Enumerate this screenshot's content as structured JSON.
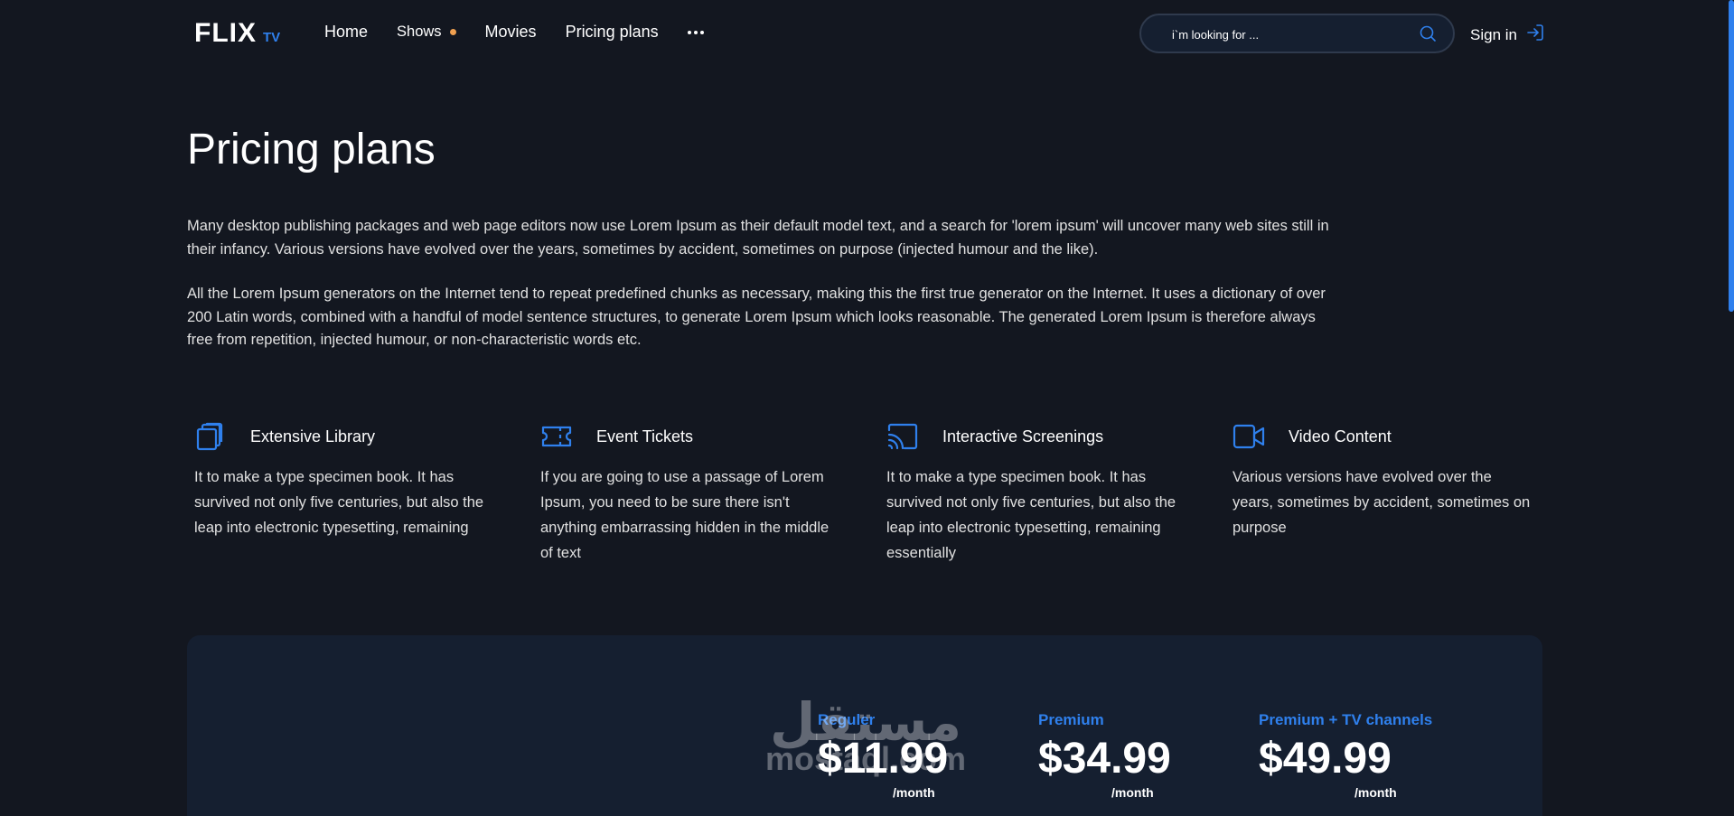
{
  "header": {
    "logo_main": "FLIX",
    "logo_sub": "TV",
    "nav": [
      {
        "label": "Home"
      },
      {
        "label": "Shows"
      },
      {
        "label": "Movies"
      },
      {
        "label": "Pricing plans"
      }
    ],
    "search_placeholder": "i`m looking for ...",
    "signin_label": "Sign in"
  },
  "main": {
    "title": "Pricing plans",
    "paragraphs": [
      "Many desktop publishing packages and web page editors now use Lorem Ipsum as their default model text, and a search for 'lorem ipsum' will uncover many web sites still in their infancy. Various versions have evolved over the years, sometimes by accident, sometimes on purpose (injected humour and the like).",
      "All the Lorem Ipsum generators on the Internet tend to repeat predefined chunks as necessary, making this the first true generator on the Internet. It uses a dictionary of over 200 Latin words, combined with a handful of model sentence structures, to generate Lorem Ipsum which looks reasonable. The generated Lorem Ipsum is therefore always free from repetition, injected humour, or non-characteristic words etc."
    ]
  },
  "features": [
    {
      "icon": "library-icon",
      "title": "Extensive Library",
      "text": "It to make a type specimen book. It has survived not only five centuries, but also the leap into electronic typesetting, remaining"
    },
    {
      "icon": "ticket-icon",
      "title": "Event Tickets",
      "text": "If you are going to use a passage of Lorem Ipsum, you need to be sure there isn't anything embarrassing hidden in the middle of text"
    },
    {
      "icon": "cast-icon",
      "title": "Interactive Screenings",
      "text": "It to make a type specimen book. It has survived not only five centuries, but also the leap into electronic typesetting, remaining essentially"
    },
    {
      "icon": "video-camera-icon",
      "title": "Video Content",
      "text": "Various versions have evolved over the years, sometimes by accident, sometimes on purpose"
    }
  ],
  "pricing": {
    "plans": [
      {
        "name": "Reguler",
        "price": "$11.99",
        "period": "/month"
      },
      {
        "name": "Premium",
        "price": "$34.99",
        "period": "/month"
      },
      {
        "name": "Premium + TV channels",
        "price": "$49.99",
        "period": "/month"
      }
    ]
  },
  "watermark": {
    "arabic": "مستقل",
    "latin": "mostaql.com"
  },
  "colors": {
    "background": "#131720",
    "panel": "#151f30",
    "accent": "#2f80ed",
    "dot": "#f0a050"
  }
}
